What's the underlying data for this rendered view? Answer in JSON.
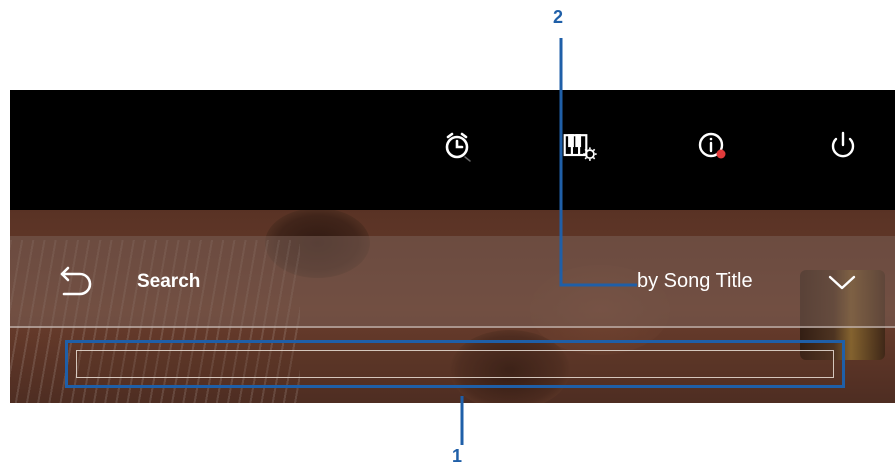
{
  "callouts": {
    "one": "1",
    "two": "2"
  },
  "topbar": {
    "icons": [
      "alarm-clock-icon",
      "piano-settings-icon",
      "info-icon",
      "power-icon"
    ],
    "info_badge_color": "#e23b3b"
  },
  "search": {
    "back_icon": "back-arrow-icon",
    "label": "Search",
    "sort_value": "by Song Title",
    "sort_icon": "chevron-down-icon",
    "input_value": "",
    "input_placeholder": ""
  },
  "colors": {
    "callout": "#1f5fa8",
    "topbar_bg": "#000000",
    "text": "#ffffff"
  }
}
